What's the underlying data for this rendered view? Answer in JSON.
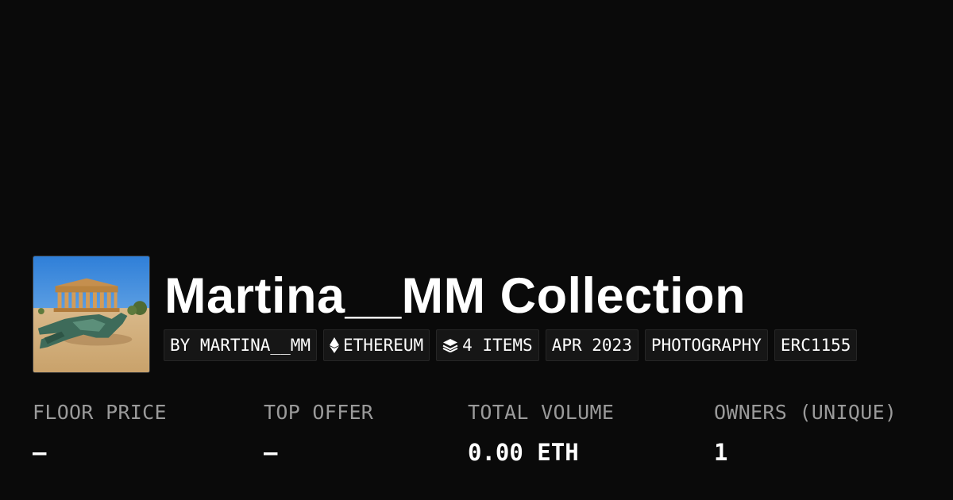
{
  "collection": {
    "title": "Martina__MM Collection",
    "avatar_icon": "collection-avatar-image"
  },
  "tags": {
    "creator": "BY MARTINA__MM",
    "chain": "ETHEREUM",
    "chain_icon": "ethereum-icon",
    "items": "4 ITEMS",
    "items_icon": "layers-icon",
    "date": "APR 2023",
    "category": "PHOTOGRAPHY",
    "standard": "ERC1155"
  },
  "stats": {
    "floor_price_label": "FLOOR PRICE",
    "floor_price_value": "–",
    "top_offer_label": "TOP OFFER",
    "top_offer_value": "–",
    "total_volume_label": "TOTAL VOLUME",
    "total_volume_value": "0.00 ETH",
    "owners_label": "OWNERS (UNIQUE)",
    "owners_value": "1"
  },
  "colors": {
    "background": "#0a0a0a",
    "tag_background": "#161616",
    "label_gray": "#9a9a9a",
    "text": "#ffffff"
  }
}
